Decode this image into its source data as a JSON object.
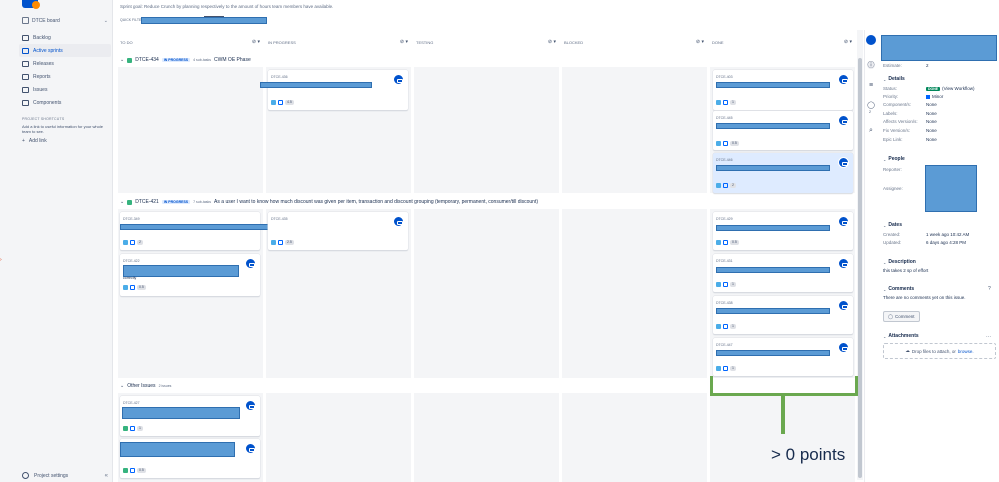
{
  "sidebar": {
    "project_name": "DTCE board",
    "items": [
      {
        "label": "Backlog",
        "icon": "backlog-icon"
      },
      {
        "label": "Active sprints",
        "icon": "board-icon",
        "active": true
      },
      {
        "label": "Releases",
        "icon": "ship-icon"
      },
      {
        "label": "Reports",
        "icon": "chart-icon"
      },
      {
        "label": "Issues",
        "icon": "issues-icon"
      },
      {
        "label": "Components",
        "icon": "component-icon"
      }
    ],
    "shortcuts_heading": "PROJECT SHORTCUTS",
    "shortcuts_text": "Add a link to useful information for your whole team to see.",
    "add_link": "Add link",
    "settings": "Project settings",
    "collapse": "«"
  },
  "header": {
    "sprint_goal": "Sprint goal: Reduce Crunch by planning respectively to the amount of hours team members have available.",
    "quick_filters": "QUICK FILTERS:"
  },
  "columns": [
    {
      "label": "TO DO"
    },
    {
      "label": "IN PROGRESS"
    },
    {
      "label": "TESTING"
    },
    {
      "label": "BLOCKED"
    },
    {
      "label": "DONE"
    }
  ],
  "column_control": "⊘ ▾",
  "swimlanes": [
    {
      "key": "DTCE-434",
      "status": "IN PROGRESS",
      "subtasks": "4 sub-tasks",
      "title": "CWM OE Phase"
    },
    {
      "key": "DTCE-421",
      "status": "IN PROGRESS",
      "subtasks": "7 sub-tasks",
      "title": "As a user I want to know how much discount was given per item, transaction and discount grouping (temporary, permanent, consumer/till discount)"
    },
    {
      "key": "",
      "status": "",
      "subtasks": "2 issues",
      "title": "Other Issues"
    }
  ],
  "cards": {
    "c1": {
      "key": "DTCE-436",
      "est": "4.5"
    },
    "c2": {
      "key": "DTCE-403",
      "est": "1"
    },
    "c3": {
      "key": "DTCE-445",
      "est": "0.5"
    },
    "c4": {
      "key": "DTCE-446",
      "est": "2"
    },
    "c5": {
      "key": "DTCE-349",
      "est": "2"
    },
    "c6": {
      "key": "DTCE-435",
      "est": "2.5"
    },
    "c7": {
      "key": "DTCE-429",
      "est": "0.5"
    },
    "c8": {
      "key": "DTCE-422",
      "text": "correctly",
      "est": "0.5"
    },
    "c9": {
      "key": "DTCE-431",
      "est": "1"
    },
    "c10": {
      "key": "DTCE-438",
      "est": "1"
    },
    "c11": {
      "key": "DTCE-447",
      "est": "1"
    },
    "c12": {
      "key": "DTCE-427",
      "est": "1"
    },
    "c13": {
      "key": "",
      "est": "0.5"
    }
  },
  "annotation": {
    "text": "> 0 points",
    "color": "#6aa84f"
  },
  "detail": {
    "estimate_label": "Estimate:",
    "estimate_value": "2",
    "details_heading": "Details",
    "status_label": "Status:",
    "status_value": "DONE",
    "view_workflow": "(View Workflow)",
    "priority_label": "Priority:",
    "priority_value": "Minor",
    "components_label": "Component/s:",
    "components_value": "None",
    "labels_label": "Labels:",
    "labels_value": "None",
    "affects_label": "Affects Version/s:",
    "affects_value": "None",
    "fix_label": "Fix Version/s:",
    "fix_value": "None",
    "epic_label": "Epic Link:",
    "epic_value": "None",
    "people_heading": "People",
    "reporter_label": "Reporter:",
    "assignee_label": "Assignee:",
    "dates_heading": "Dates",
    "created_label": "Created:",
    "created_value": "1 week ago 10:42 AM",
    "updated_label": "Updated:",
    "updated_value": "6 days ago 4:28 PM",
    "description_heading": "Description",
    "description_text": "this takes 2 sp of effort",
    "comments_heading": "Comments",
    "comments_text": "There are no comments yet on this issue.",
    "comment_button": "Comment",
    "attachments_heading": "Attachments",
    "drop_text": "Drop files to attach, or",
    "browse": "browse."
  },
  "rail": {
    "comment_count": "2"
  },
  "colors": {
    "accent": "#0052cc",
    "done": "#00875a",
    "redaction": "#5b9bd5",
    "annotation": "#6aa84f"
  }
}
